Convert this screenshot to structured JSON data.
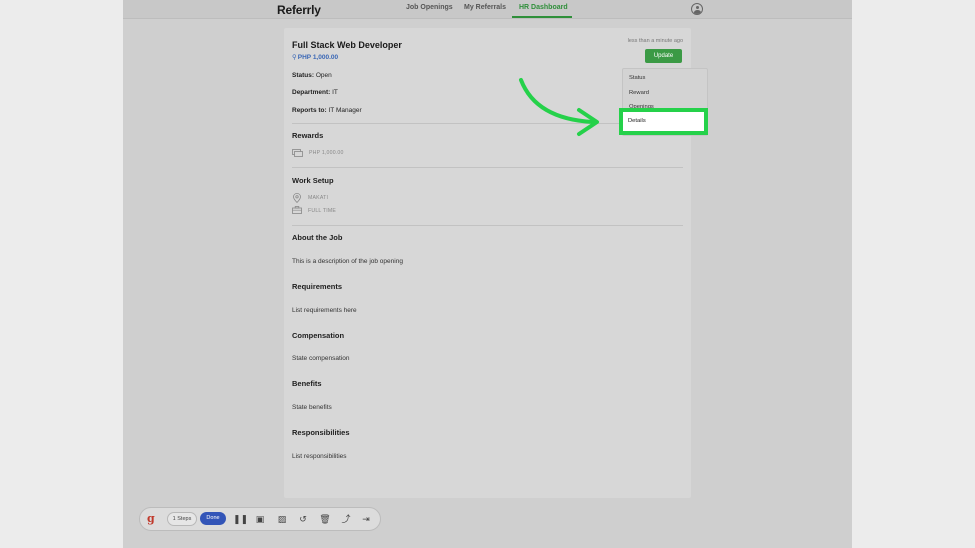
{
  "app": {
    "brand": "Referrly",
    "nav": [
      "Job Openings",
      "My Referrals",
      "HR Dashboard"
    ],
    "active_nav": "HR Dashboard"
  },
  "job": {
    "title": "Full Stack Web Developer",
    "reward": "PHP 1,000.00",
    "timestamp": "less than a minute ago",
    "update_label": "Update",
    "status_label": "Status:",
    "status_value": "Open",
    "department_label": "Department:",
    "department_value": "IT",
    "reports_label": "Reports to:",
    "reports_value": "IT Manager"
  },
  "sections": {
    "rewards": {
      "heading": "Rewards",
      "value": "PHP 1,000.00"
    },
    "work_setup": {
      "heading": "Work Setup",
      "location": "MAKATI",
      "type": "FULL TIME"
    },
    "about": {
      "heading": "About the Job",
      "text": "This is a description of the job opening"
    },
    "requirements": {
      "heading": "Requirements",
      "text": "List requirements here"
    },
    "compensation": {
      "heading": "Compensation",
      "text": "State compensation"
    },
    "benefits": {
      "heading": "Benefits",
      "text": "State benefits"
    },
    "responsibilities": {
      "heading": "Responsibilities",
      "text": "List responsibilities"
    }
  },
  "dropdown": {
    "items": [
      "Status",
      "Reward",
      "Openings",
      "Details"
    ],
    "selected": "Details"
  },
  "recorder": {
    "logo": "g",
    "steps": "1 Steps",
    "done": "Done",
    "icons": [
      "pause-icon",
      "stop-icon",
      "image-icon",
      "undo-icon",
      "trash-icon",
      "share-icon",
      "exit-icon"
    ]
  },
  "colors": {
    "accent_green": "#2f8f3a",
    "update_button": "#3b9a45",
    "highlight": "#25d14a",
    "reward_blue": "#3a67b5",
    "done_button": "#3355b8"
  }
}
